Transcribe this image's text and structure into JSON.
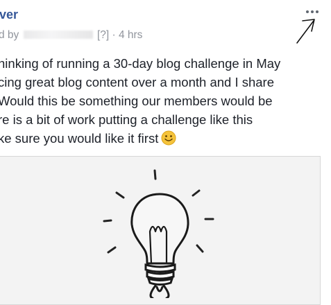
{
  "post": {
    "author_name": "ver",
    "meta_prefix": "d by",
    "meta_suffix": "[?] · 4 hrs",
    "more_menu_label": "More options",
    "body_lines": [
      "hinking of running a 30-day blog challenge in May",
      "cing great blog content over a month and I share",
      "Would this be something our members would be",
      "re is a bit of work putting a challenge like this",
      "ke sure you would like it first"
    ],
    "emoji": "smiley-emoji",
    "image_subject": "lightbulb-illustration"
  },
  "colors": {
    "author": "#365899",
    "meta": "#90949c",
    "body": "#1d2129",
    "dots": "#606770",
    "image_bg": "#f3f3f3",
    "emoji_yellow": "#f5c33b"
  }
}
